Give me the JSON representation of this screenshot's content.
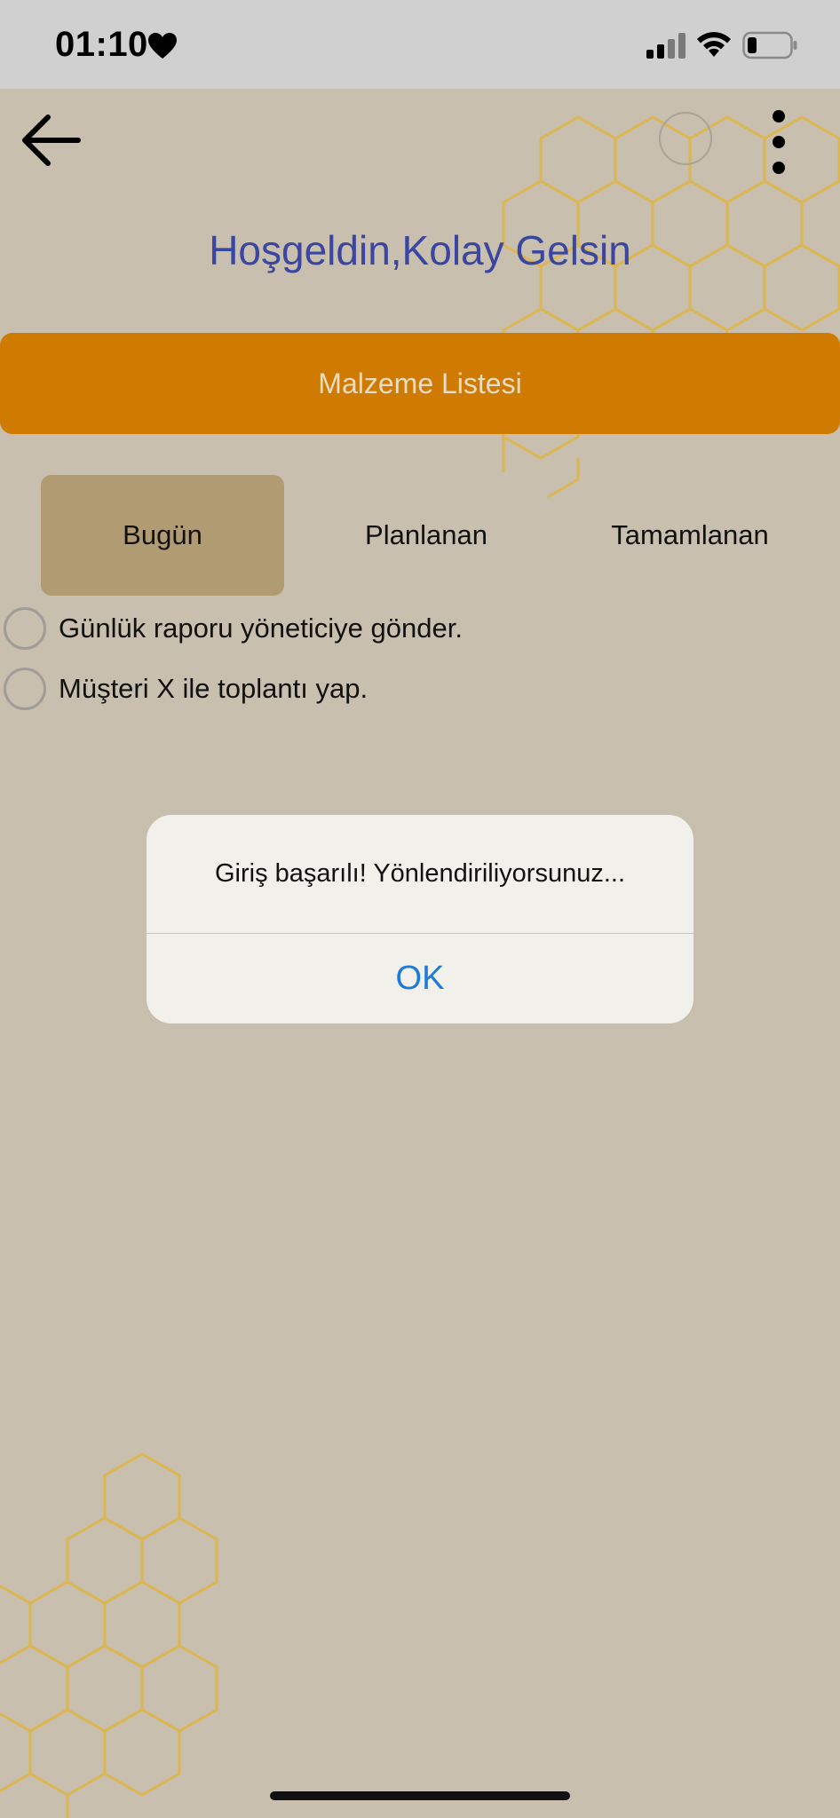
{
  "status_bar": {
    "time": "01:10",
    "icons": [
      "heart-icon",
      "signal-icon",
      "wifi-icon",
      "battery-icon"
    ]
  },
  "header": {
    "back_icon": "back-arrow-icon",
    "menu_icon": "more-vertical-icon",
    "title": "Hoşgeldin,Kolay Gelsin"
  },
  "material_list_button": {
    "label": "Malzeme Listesi"
  },
  "tabs": [
    {
      "label": "Bugün",
      "selected": true
    },
    {
      "label": "Planlanan",
      "selected": false
    },
    {
      "label": "Tamamlanan",
      "selected": false
    }
  ],
  "tasks": [
    {
      "label": "Günlük raporu yöneticiye gönder.",
      "done": false
    },
    {
      "label": "Müşteri X ile toplantı yap.",
      "done": false
    }
  ],
  "alert": {
    "message": "Giriş başarılı! Yönlendiriliyorsunuz...",
    "ok_label": "OK"
  },
  "colors": {
    "background": "#c9bfae",
    "title": "#3a46a0",
    "primary_button": "#cf7a00",
    "selected_tab": "#b09b72",
    "alert_button": "#1e7bd8",
    "honeycomb": "#e0b540"
  }
}
